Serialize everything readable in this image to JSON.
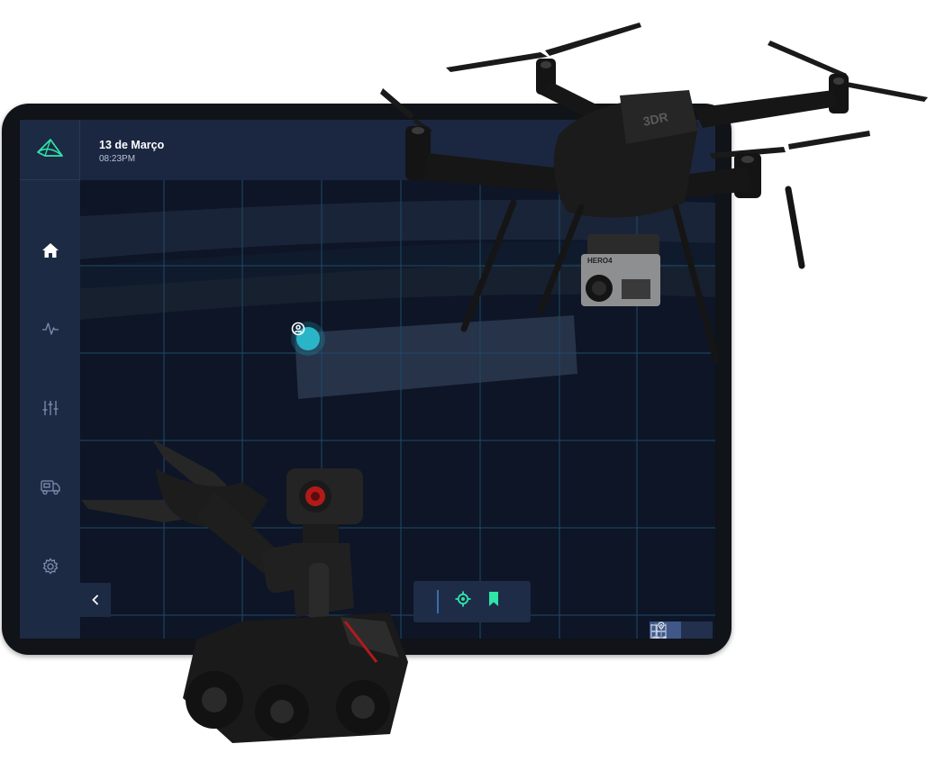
{
  "header": {
    "date": "13 de Março",
    "time": "08:23PM"
  },
  "sidebar": {
    "logo_icon": "leaf-logo-icon",
    "items": [
      {
        "id": "home",
        "icon": "home-icon",
        "active": true
      },
      {
        "id": "activity",
        "icon": "activity-pulse-icon",
        "active": false
      },
      {
        "id": "controls",
        "icon": "sliders-icon",
        "active": false
      },
      {
        "id": "vehicle",
        "icon": "vehicle-icon",
        "active": false
      },
      {
        "id": "settings",
        "icon": "gear-icon",
        "active": false
      }
    ],
    "collapse_icon": "chevron-left-icon"
  },
  "map": {
    "user_pin_icon": "user-pin-icon",
    "actions": [
      {
        "id": "locate",
        "icon": "crosshair-icon"
      },
      {
        "id": "bookmark",
        "icon": "bookmark-icon"
      }
    ],
    "view_toggle": [
      {
        "id": "grid-map",
        "icon": "map-grid-icon",
        "active": true
      },
      {
        "id": "fold-map",
        "icon": "folded-map-icon",
        "active": false
      }
    ]
  },
  "overlays": {
    "drone_body_text": "3DR",
    "camera_brand_text": "HERO4"
  },
  "colors": {
    "accent": "#2ee6a8",
    "pin": "#2ab4c8",
    "sidebar": "#1d2a44",
    "map_bg": "#0d1526",
    "grid": "#1f4a66"
  }
}
